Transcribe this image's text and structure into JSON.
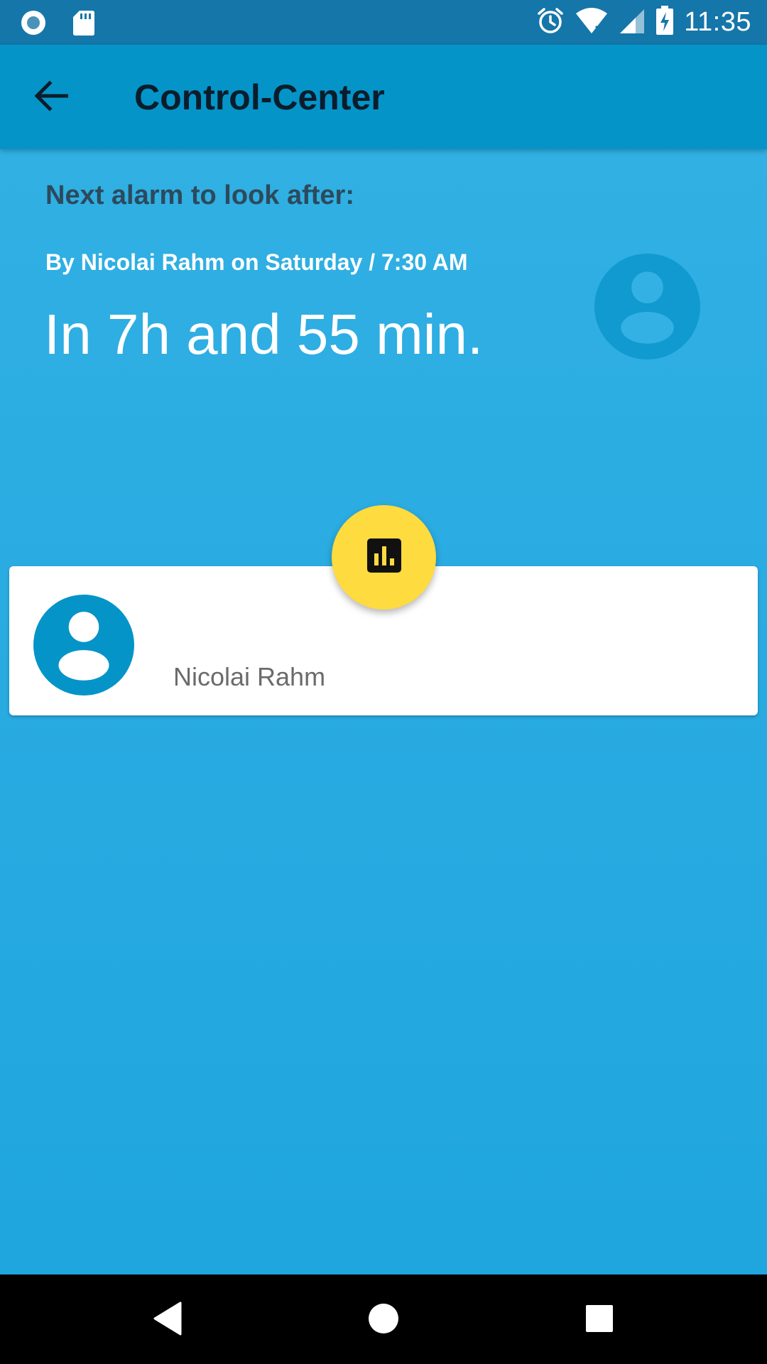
{
  "status_bar": {
    "time": "11:35",
    "left_icons": [
      "circle-indicator-icon",
      "sd-card-icon"
    ],
    "right_icons": [
      "alarm-icon",
      "wifi-icon",
      "signal-icon",
      "battery-charging-icon"
    ]
  },
  "app_bar": {
    "title": "Control-Center",
    "back_icon": "arrow-back-icon"
  },
  "alarm": {
    "heading": "Next alarm to look after:",
    "by_line": "By Nicolai Rahm on Saturday / 7:30 AM",
    "countdown": "In 7h and 55 min."
  },
  "card": {
    "user_name": "Nicolai Rahm"
  },
  "fab": {
    "icon": "bar-chart-icon"
  },
  "nav_bar": {
    "buttons": [
      "back-triangle-icon",
      "home-circle-icon",
      "recents-square-icon"
    ]
  },
  "colors": {
    "status_bar": "#1576a9",
    "app_bar": "#0594c8",
    "background": "#2aadE2",
    "avatar": "#0594c8",
    "fab": "#fedb3e"
  }
}
